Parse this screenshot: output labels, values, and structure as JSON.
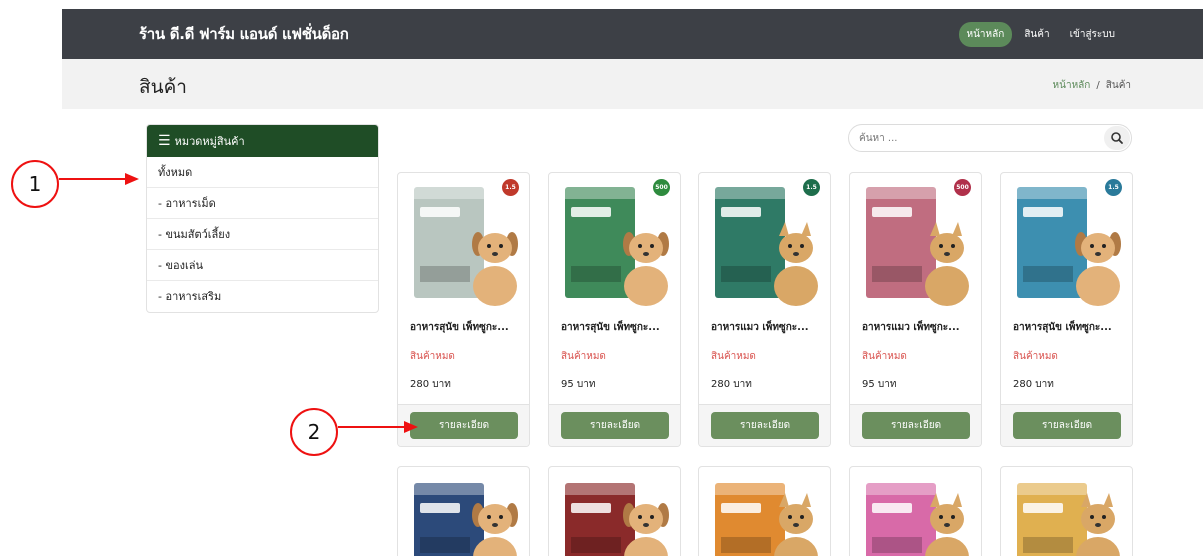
{
  "navbar": {
    "brand": "ร้าน ดี.ดี ฟาร์ม แอนด์ แฟชั่นด็อก",
    "links": [
      {
        "label": "หน้าหลัก",
        "active": true
      },
      {
        "label": "สินค้า",
        "active": false
      },
      {
        "label": "เข้าสู่ระบบ",
        "active": false
      }
    ]
  },
  "page": {
    "title": "สินค้า",
    "breadcrumb": {
      "home": "หน้าหลัก",
      "separator": "/",
      "current": "สินค้า"
    }
  },
  "sidebar": {
    "title": "หมวดหมู่สินค้า",
    "icon": "menu-icon",
    "items": [
      {
        "label": "ทั้งหมด"
      },
      {
        "label": "- อาหารเม็ด"
      },
      {
        "label": "- ขนมสัตว์เลี้ยง"
      },
      {
        "label": "- ของเล่น"
      },
      {
        "label": "- อาหารเสริม"
      }
    ]
  },
  "search": {
    "placeholder": "ค้นหา ...",
    "icon": "search-icon"
  },
  "products": [
    {
      "name": "อาหารสุนัข เพ็ทซูกะ...",
      "status": "สินค้าหมด",
      "price": "280 บาท",
      "button": "รายละเอียด",
      "badge": "1.5",
      "badge_color": "#c0392b",
      "bag_color": "#b9c6c0",
      "animal": "dog"
    },
    {
      "name": "อาหารสุนัข เพ็ทซูกะ...",
      "status": "สินค้าหมด",
      "price": "95 บาท",
      "button": "รายละเอียด",
      "badge": "500",
      "badge_color": "#2e8b3e",
      "bag_color": "#3f8a5a",
      "animal": "dog"
    },
    {
      "name": "อาหารแมว เพ็ทซูกะ...",
      "status": "สินค้าหมด",
      "price": "280 บาท",
      "button": "รายละเอียด",
      "badge": "1.5",
      "badge_color": "#1e6e4c",
      "bag_color": "#2f7a66",
      "animal": "cat"
    },
    {
      "name": "อาหารแมว เพ็ทซูกะ...",
      "status": "สินค้าหมด",
      "price": "95 บาท",
      "button": "รายละเอียด",
      "badge": "500",
      "badge_color": "#b0304a",
      "bag_color": "#c06d80",
      "animal": "cat"
    },
    {
      "name": "อาหารสุนัข เพ็ทซูกะ...",
      "status": "สินค้าหมด",
      "price": "280 บาท",
      "button": "รายละเอียด",
      "badge": "1.5",
      "badge_color": "#2a7a9a",
      "bag_color": "#3d8fb0",
      "animal": "dog"
    }
  ],
  "products_row2": [
    {
      "bag_color": "#2c4a7a",
      "animal": "dog"
    },
    {
      "bag_color": "#8a2a2a",
      "animal": "dog"
    },
    {
      "bag_color": "#e08a30",
      "animal": "cat"
    },
    {
      "bag_color": "#d86aa8",
      "animal": "cat"
    },
    {
      "bag_color": "#e0b050",
      "animal": "cat"
    }
  ],
  "annotations": [
    {
      "label": "1"
    },
    {
      "label": "2"
    }
  ],
  "colors": {
    "navbar": "#3d4046",
    "accent_green": "#5c8a5a",
    "sidebar_header": "#1f4d26",
    "out_of_stock": "#d9534f",
    "detail_button": "#6b8f5e",
    "annotation_red": "#ee1111"
  }
}
